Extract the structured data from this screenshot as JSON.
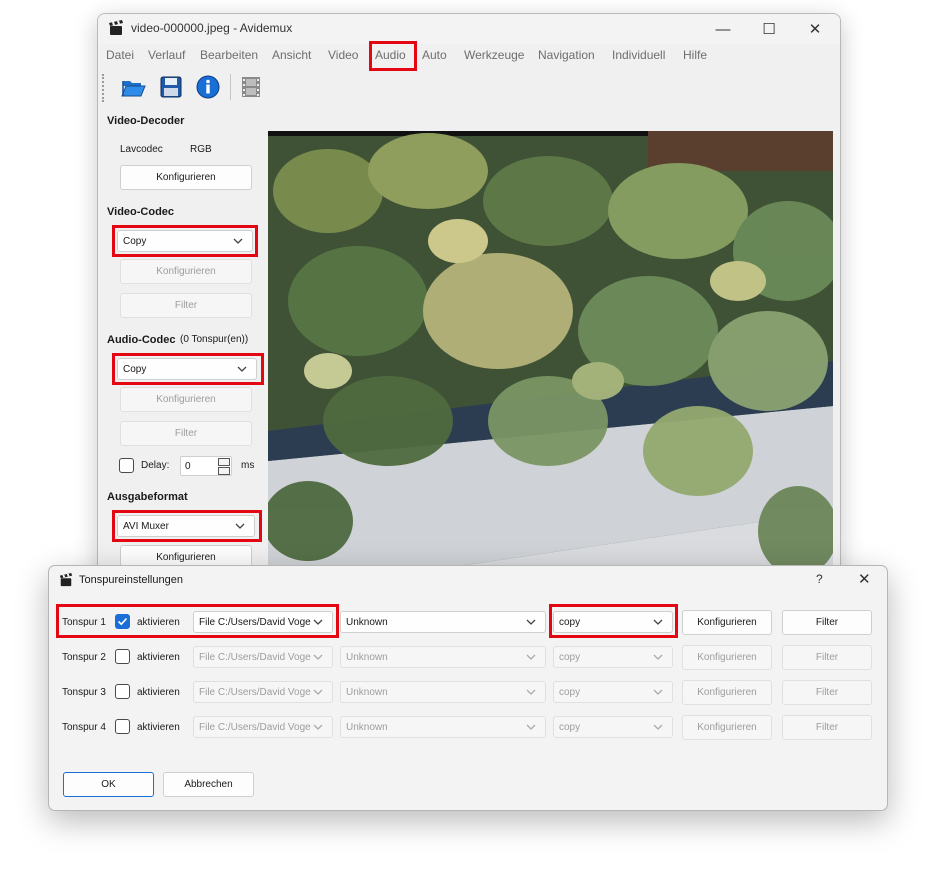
{
  "window": {
    "title": "video-000000.jpeg - Avidemux",
    "controls": {
      "minimize": "—",
      "maximize": "☐",
      "close": "✕"
    }
  },
  "menu": [
    "Datei",
    "Verlauf",
    "Bearbeiten",
    "Ansicht",
    "Video",
    "Audio",
    "Auto",
    "Werkzeuge",
    "Navigation",
    "Individuell",
    "Hilfe"
  ],
  "toolbar": {
    "icons": [
      "open-folder-icon",
      "save-disk-icon",
      "info-icon",
      "film-strip-icon"
    ]
  },
  "left_panel": {
    "video_decoder": {
      "title": "Video-Decoder",
      "decoder": "Lavcodec",
      "format": "RGB",
      "configure": "Konfigurieren"
    },
    "video_codec": {
      "title": "Video-Codec",
      "selected": "Copy",
      "configure": "Konfigurieren",
      "filter": "Filter"
    },
    "audio_codec": {
      "title": "Audio-Codec",
      "tracks_info": "(0 Tonspur(en))",
      "selected": "Copy",
      "configure": "Konfigurieren",
      "filter": "Filter",
      "delay_label": "Delay:",
      "delay_value": "0",
      "delay_unit": "ms"
    },
    "output_format": {
      "title": "Ausgabeformat",
      "selected": "AVI Muxer",
      "configure": "Konfigurieren"
    }
  },
  "dialog": {
    "title": "Tonspureinstellungen",
    "help": "?",
    "close": "✕",
    "tracks": [
      {
        "label": "Tonspur 1",
        "checked": true,
        "activate": "aktivieren",
        "file": "File C:/Users/David Voge",
        "language": "Unknown",
        "codec": "copy",
        "configure": "Konfigurieren",
        "filter": "Filter"
      },
      {
        "label": "Tonspur 2",
        "checked": false,
        "activate": "aktivieren",
        "file": "File C:/Users/David Voge",
        "language": "Unknown",
        "codec": "copy",
        "configure": "Konfigurieren",
        "filter": "Filter"
      },
      {
        "label": "Tonspur 3",
        "checked": false,
        "activate": "aktivieren",
        "file": "File C:/Users/David Voge",
        "language": "Unknown",
        "codec": "copy",
        "configure": "Konfigurieren",
        "filter": "Filter"
      },
      {
        "label": "Tonspur 4",
        "checked": false,
        "activate": "aktivieren",
        "file": "File C:/Users/David Voge",
        "language": "Unknown",
        "codec": "copy",
        "configure": "Konfigurieren",
        "filter": "Filter"
      }
    ],
    "ok": "OK",
    "cancel": "Abbrechen"
  },
  "colors": {
    "highlight": "#e30613",
    "accent": "#1a6fd6"
  }
}
